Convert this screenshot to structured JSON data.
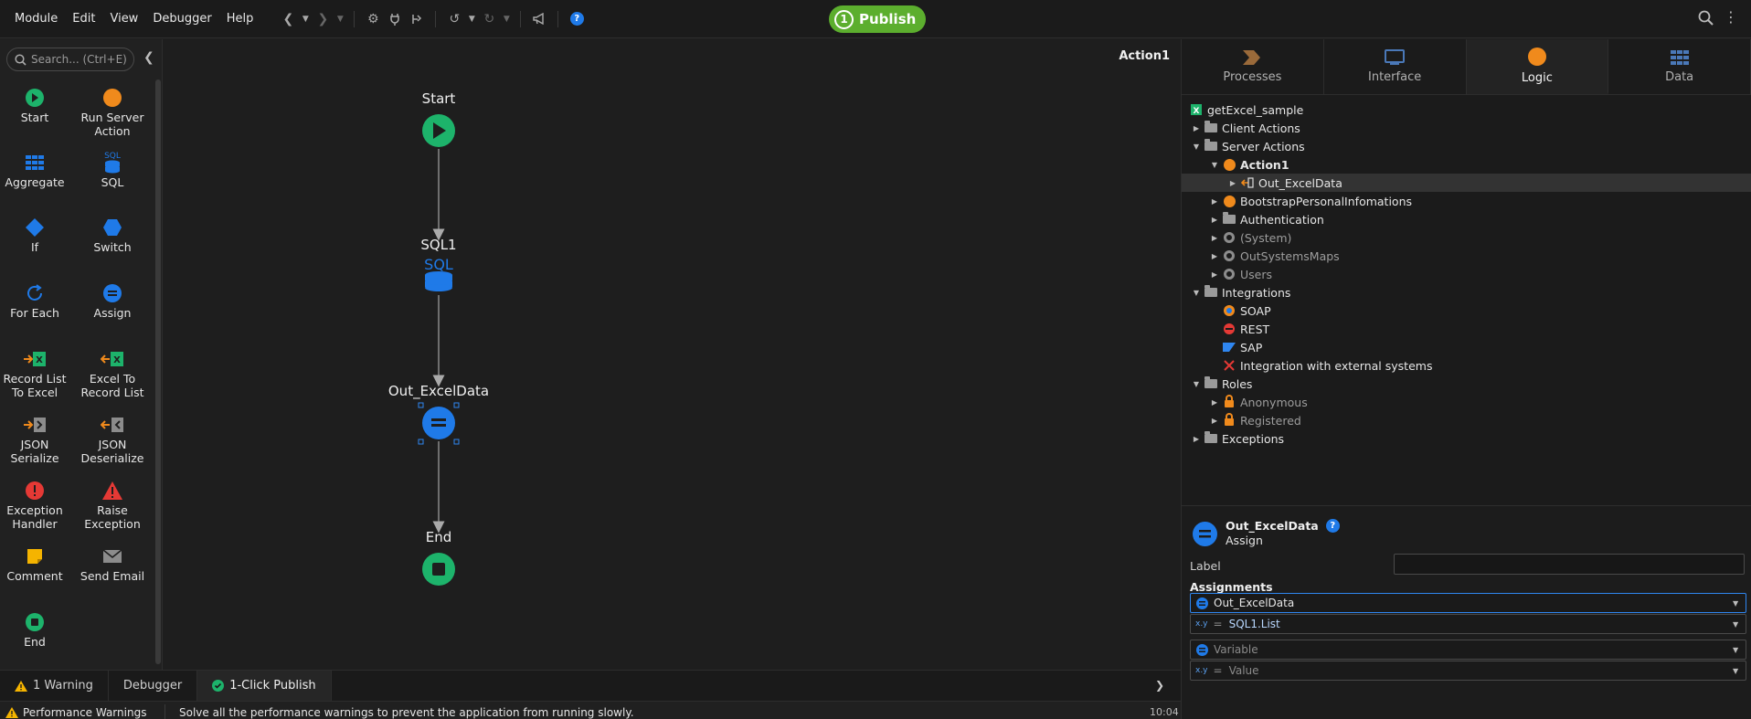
{
  "menu": [
    "Module",
    "Edit",
    "View",
    "Debugger",
    "Help"
  ],
  "publish": {
    "number": "1",
    "label": "Publish"
  },
  "toolbox": {
    "search_placeholder": "Search... (Ctrl+E)",
    "tools": [
      {
        "name": "start",
        "label": "Start",
        "icon": "start-icon",
        "color": "#1db36b"
      },
      {
        "name": "run-server-action",
        "label": "Run Server Action",
        "icon": "server-action-icon",
        "color": "#f08a1c"
      },
      {
        "name": "aggregate",
        "label": "Aggregate",
        "icon": "aggregate-icon",
        "color": "#1f7ae8"
      },
      {
        "name": "sql",
        "label": "SQL",
        "icon": "sql-icon",
        "color": "#1f7ae8"
      },
      {
        "name": "if",
        "label": "If",
        "icon": "if-icon",
        "color": "#1f7ae8"
      },
      {
        "name": "switch",
        "label": "Switch",
        "icon": "switch-icon",
        "color": "#1f7ae8"
      },
      {
        "name": "for-each",
        "label": "For Each",
        "icon": "for-each-icon",
        "color": "#1f7ae8"
      },
      {
        "name": "assign",
        "label": "Assign",
        "icon": "assign-icon",
        "color": "#1f7ae8"
      },
      {
        "name": "record-list-to-excel",
        "label": "Record List To Excel",
        "icon": "record-list-to-excel-icon",
        "color": "#1db36b"
      },
      {
        "name": "excel-to-record-list",
        "label": "Excel To Record List",
        "icon": "excel-to-record-list-icon",
        "color": "#1db36b"
      },
      {
        "name": "json-serialize",
        "label": "JSON Serialize",
        "icon": "json-serialize-icon",
        "color": "#9a9a9a"
      },
      {
        "name": "json-deserialize",
        "label": "JSON Deserialize",
        "icon": "json-deserialize-icon",
        "color": "#9a9a9a"
      },
      {
        "name": "exception-handler",
        "label": "Exception Handler",
        "icon": "exception-handler-icon",
        "color": "#e53935"
      },
      {
        "name": "raise-exception",
        "label": "Raise Exception",
        "icon": "raise-exception-icon",
        "color": "#e53935"
      },
      {
        "name": "comment",
        "label": "Comment",
        "icon": "comment-icon",
        "color": "#f5b400"
      },
      {
        "name": "send-email",
        "label": "Send Email",
        "icon": "email-icon",
        "color": "#9a9a9a"
      },
      {
        "name": "end",
        "label": "End",
        "icon": "end-icon",
        "color": "#1db36b"
      }
    ]
  },
  "canvas": {
    "title": "Action1",
    "nodes": {
      "start": "Start",
      "sql": "SQL1",
      "sql_glyph": "SQL",
      "assign": "Out_ExcelData",
      "end": "End"
    }
  },
  "bottom_tabs": [
    {
      "label": "1 Warning",
      "icon": "warning-icon"
    },
    {
      "label": "Debugger",
      "icon": ""
    },
    {
      "label": "1-Click Publish",
      "icon": "check-icon"
    }
  ],
  "status": {
    "title": "Performance Warnings",
    "message": "Solve all the performance warnings to prevent the application from running slowly.",
    "time": "10:04"
  },
  "right_tabs": [
    {
      "label": "Processes",
      "icon": "processes-icon"
    },
    {
      "label": "Interface",
      "icon": "interface-icon"
    },
    {
      "label": "Logic",
      "icon": "logic-icon"
    },
    {
      "label": "Data",
      "icon": "data-icon"
    }
  ],
  "tree": {
    "root": "getExcel_sample",
    "client_actions": "Client Actions",
    "server_actions": "Server Actions",
    "action1": "Action1",
    "out_excel": "Out_ExcelData",
    "bootstrap": "BootstrapPersonalInfomations",
    "authentication": "Authentication",
    "system": "(System)",
    "osmaps": "OutSystemsMaps",
    "users": "Users",
    "integrations": "Integrations",
    "soap": "SOAP",
    "rest": "REST",
    "sap": "SAP",
    "external": "Integration with external systems",
    "roles": "Roles",
    "anonymous": "Anonymous",
    "registered": "Registered",
    "exceptions": "Exceptions"
  },
  "properties": {
    "name": "Out_ExcelData",
    "type": "Assign",
    "label_field": "Label",
    "label_value": "",
    "assignments_title": "Assignments",
    "assign_variable": "Out_ExcelData",
    "assign_value": "SQL1.List",
    "variable_placeholder": "Variable",
    "value_placeholder": "Value",
    "xy_label": "x.y",
    "equals": "="
  }
}
